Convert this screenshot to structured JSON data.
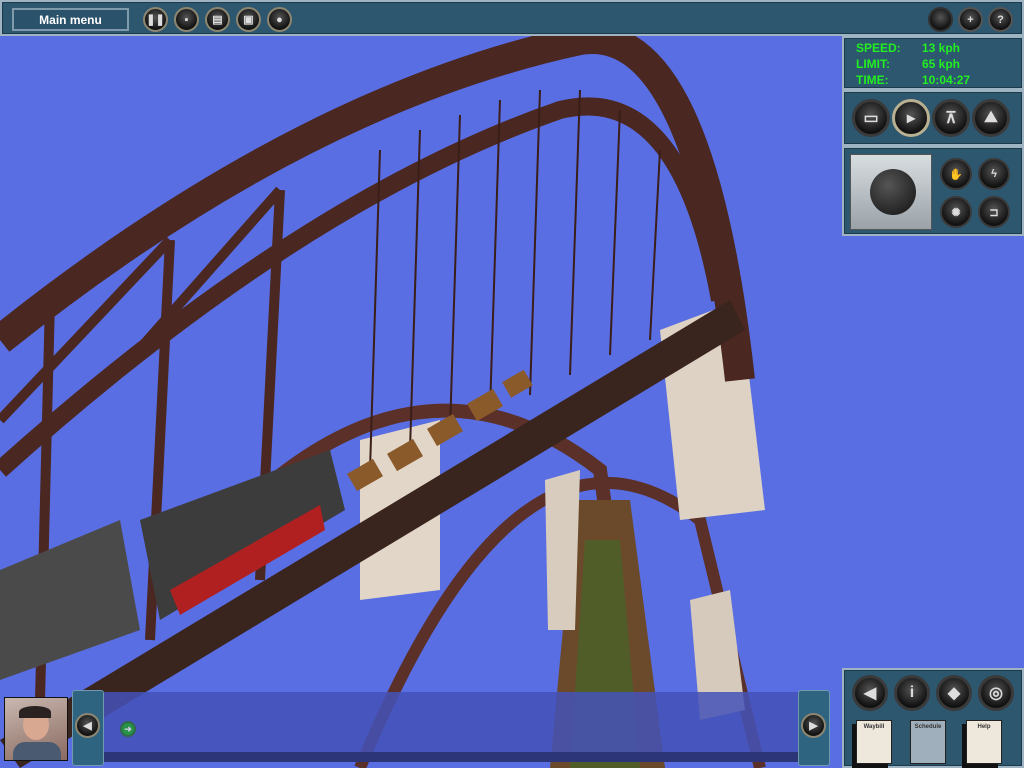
{
  "topbar": {
    "main_menu_label": "Main menu",
    "left_buttons": [
      "pause-icon",
      "save-icon",
      "screenshot-icon",
      "settings-icon",
      "record-icon"
    ],
    "right_buttons": [
      {
        "icon": "zoom-out-icon",
        "label": ""
      },
      {
        "icon": "zoom-in-icon",
        "label": "+"
      },
      {
        "icon": "help-icon",
        "label": "?"
      }
    ]
  },
  "readout": {
    "speed_label": "SPEED:",
    "speed_value": "13 kph",
    "limit_label": "LIMIT:",
    "limit_value": "65 kph",
    "time_label": "TIME:",
    "time_value": "10:04:27",
    "color": "#22ee22"
  },
  "camera_buttons": [
    "cab-view-icon",
    "external-view-icon",
    "tripod-camera-icon",
    "free-roam-icon"
  ],
  "controls": {
    "buttons": [
      "hand-brake-icon",
      "lightning-icon",
      "headlight-icon",
      "horn-icon"
    ]
  },
  "bottom_panel": {
    "buttons": [
      "sound-icon",
      "info-icon",
      "driver-icon",
      "view-icon"
    ],
    "documents": [
      {
        "label": "Waybill"
      },
      {
        "label": "Schedule"
      },
      {
        "label": "Help"
      }
    ]
  },
  "messages": {
    "prev": "left-arrow",
    "next": "right-arrow"
  }
}
